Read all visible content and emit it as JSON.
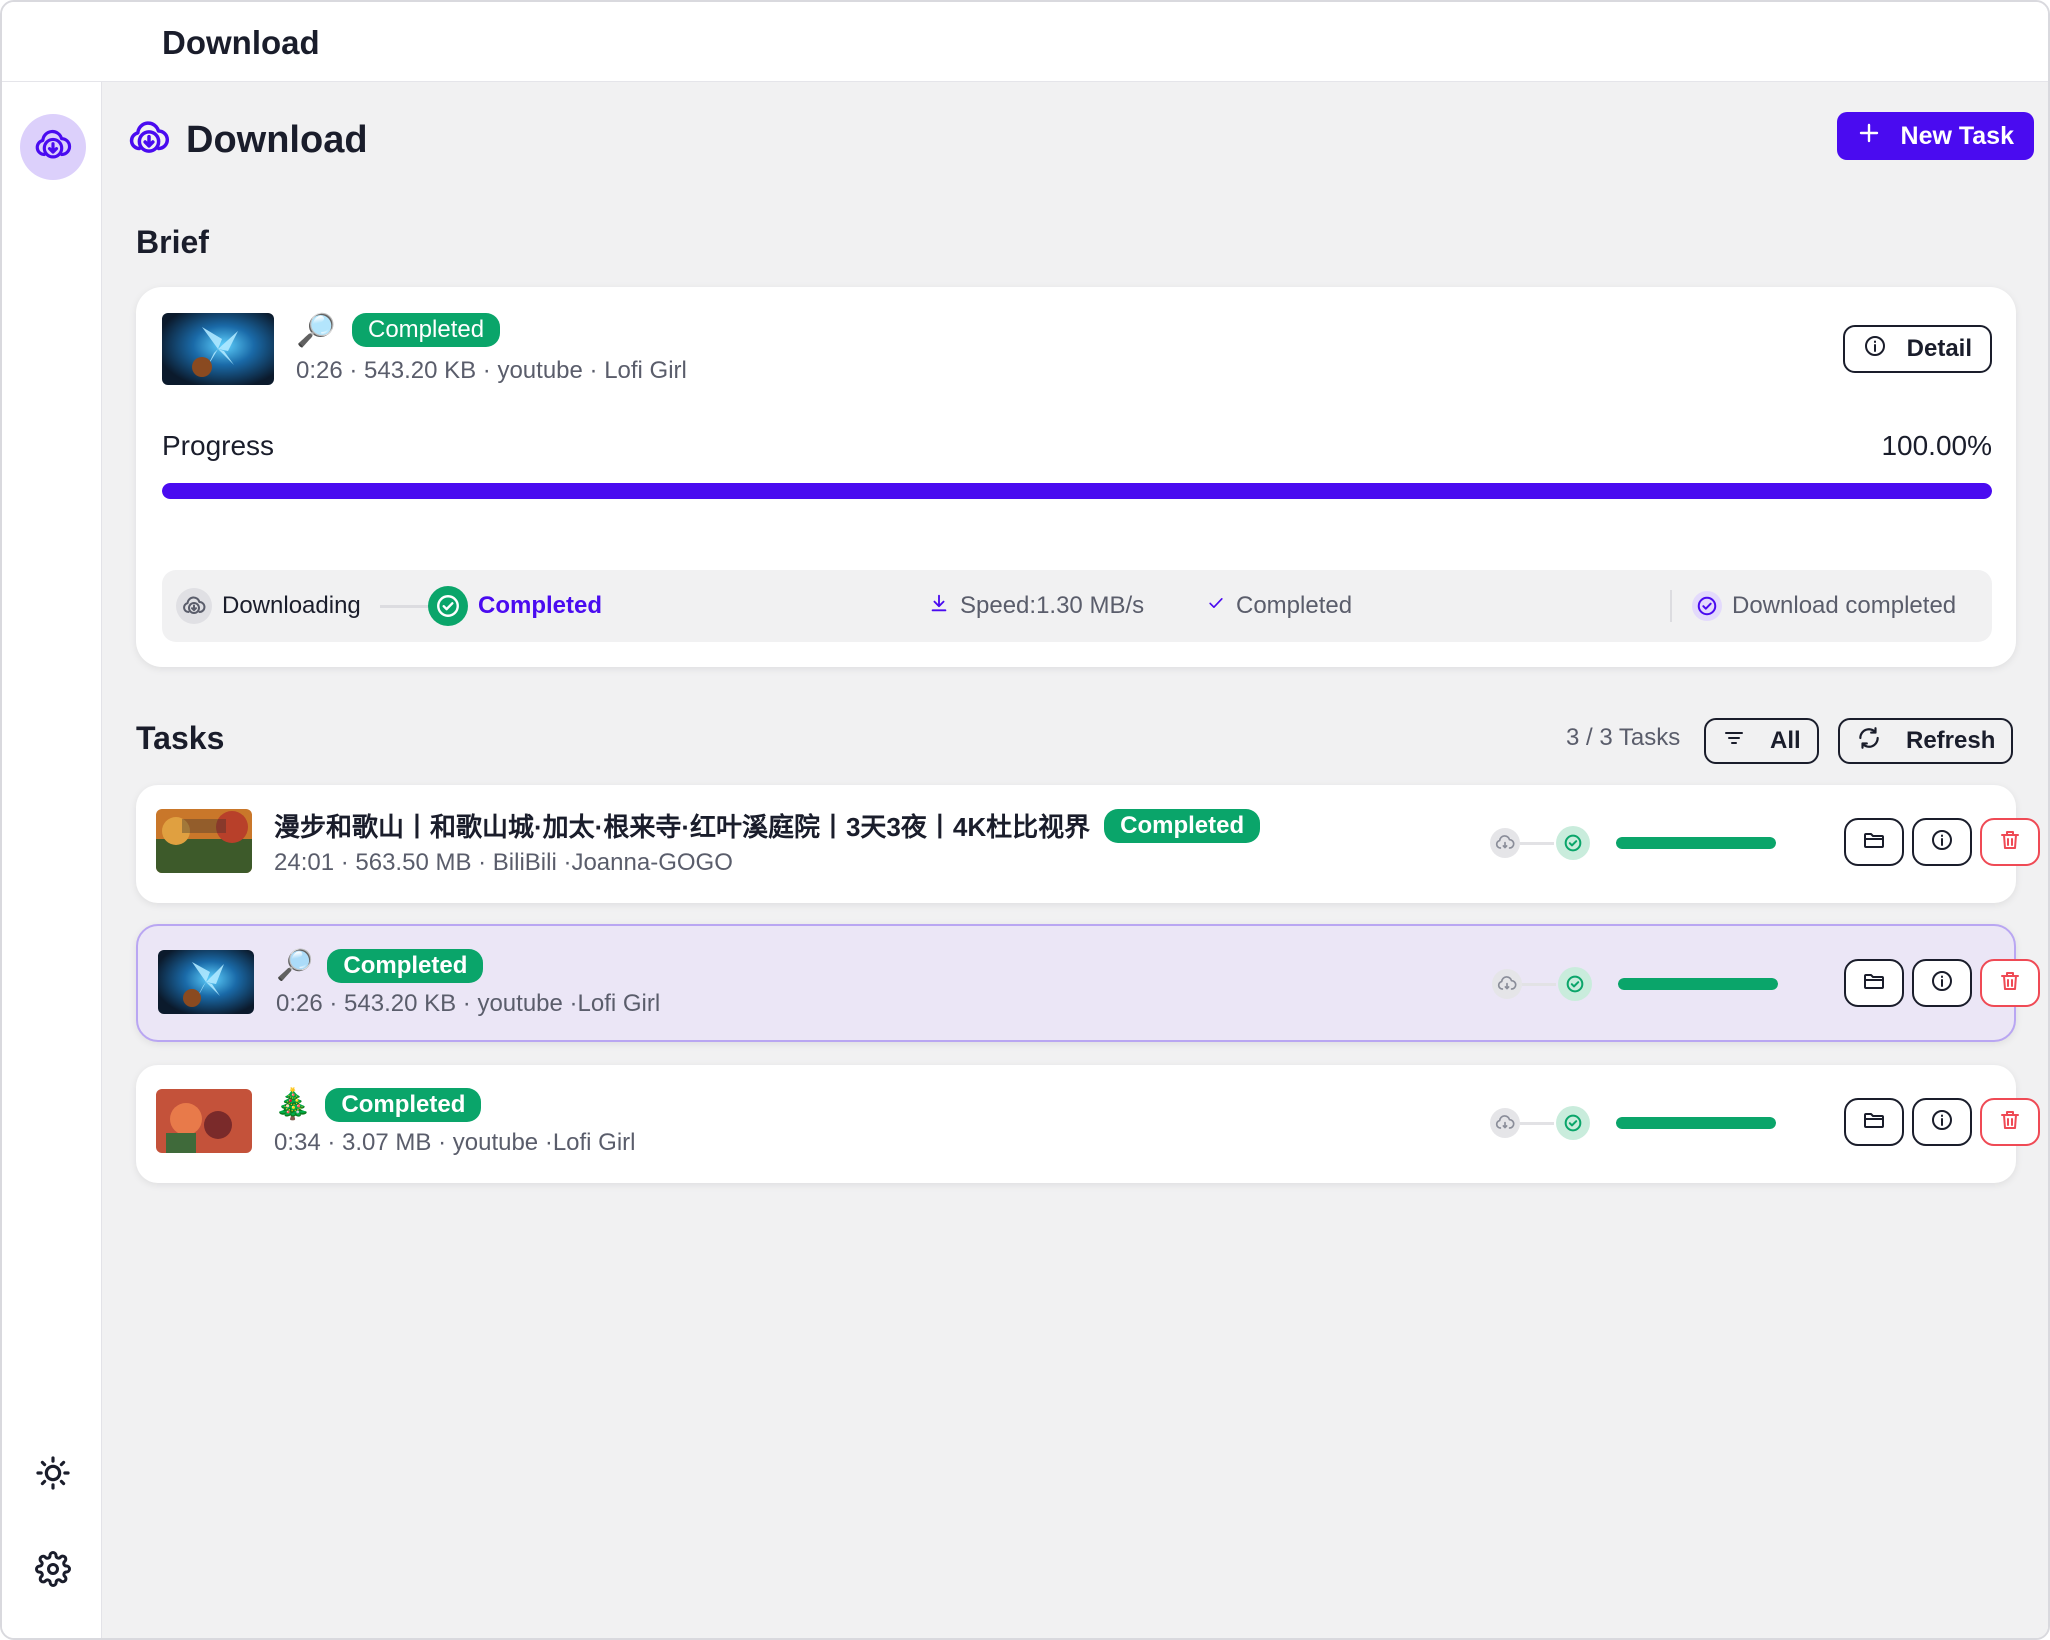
{
  "window": {
    "title": "Download"
  },
  "sidebar": {
    "items": [
      {
        "icon": "cloud-download-icon",
        "active": true
      },
      {
        "icon": "sun-icon"
      },
      {
        "icon": "gear-icon"
      }
    ]
  },
  "header": {
    "title": "Download",
    "icon": "cloud-download-icon",
    "new_task_label": "New Task"
  },
  "brief": {
    "section_title": "Brief",
    "emoji": "🔎",
    "status": "Completed",
    "meta": "0:26 · 543.20 KB · youtube · Lofi Girl",
    "detail_label": "Detail",
    "progress_label": "Progress",
    "progress_value": "100.00%",
    "progress_fraction": 1.0,
    "steps": {
      "downloading": "Downloading",
      "completed": "Completed"
    },
    "speed": "Speed:1.30 MB/s",
    "state": "Completed",
    "message": "Download completed"
  },
  "tasks": {
    "section_title": "Tasks",
    "count": "3 / 3 Tasks",
    "filter_label": "All",
    "refresh_label": "Refresh",
    "items": [
      {
        "title": "漫步和歌山丨和歌山城·加太·根来寺·红叶溪庭院丨3天3夜丨4K杜比视界",
        "status": "Completed",
        "meta": "24:01 · 563.50 MB · BiliBili ·Joanna-GOGO",
        "progress_fraction": 1.0,
        "selected": false
      },
      {
        "title": "🔎",
        "status": "Completed",
        "meta": "0:26 · 543.20 KB · youtube ·Lofi Girl",
        "progress_fraction": 1.0,
        "selected": true
      },
      {
        "title": "🎄",
        "status": "Completed",
        "meta": "0:34 · 3.07 MB · youtube ·Lofi Girl",
        "progress_fraction": 1.0,
        "selected": false
      }
    ]
  },
  "colors": {
    "accent": "#4a0bf0",
    "success": "#0aa56a",
    "danger": "#ef4a55"
  }
}
